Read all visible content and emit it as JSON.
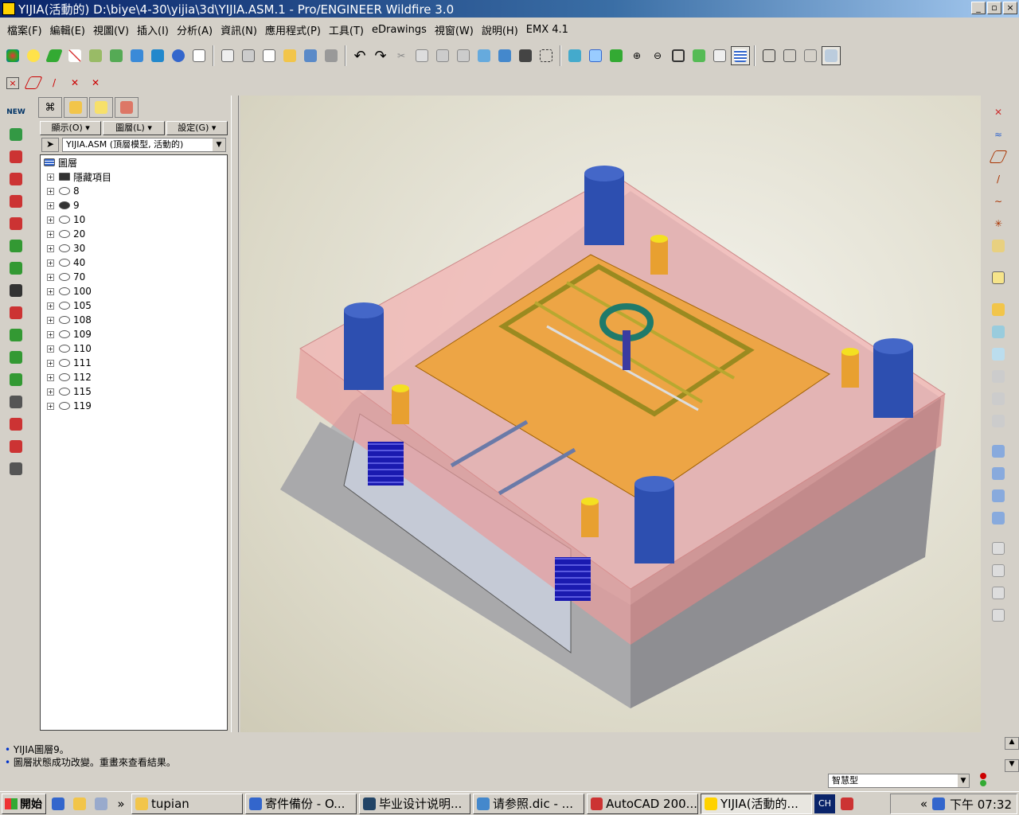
{
  "window": {
    "title": "YIJIA(活動的) D:\\biye\\4-30\\yijia\\3d\\YIJIA.ASM.1 - Pro/ENGINEER Wildfire 3.0",
    "min": "_",
    "max": "▫",
    "close": "×"
  },
  "menu": [
    "檔案(F)",
    "編輯(E)",
    "視圖(V)",
    "插入(I)",
    "分析(A)",
    "資訊(N)",
    "應用程式(P)",
    "工具(T)",
    "eDrawings",
    "視窗(W)",
    "說明(H)",
    "EMX 4.1"
  ],
  "nav": {
    "buttons": [
      "顯示(O) ▾",
      "圖層(L) ▾",
      "設定(G) ▾"
    ],
    "model_selector": "YIJIA.ASM (頂層模型, 活動的)",
    "tree_root": "圖層",
    "tree_items": [
      "隱藏項目",
      "8",
      "9",
      "10",
      "20",
      "30",
      "40",
      "70",
      "100",
      "105",
      "108",
      "109",
      "110",
      "111",
      "112",
      "115",
      "119"
    ]
  },
  "messages": [
    "YIJIA圖層9。",
    "圖層狀態成功改變。重畫來查看結果。"
  ],
  "status": {
    "filter": "智慧型"
  },
  "taskbar": {
    "start": "開始",
    "tasks": [
      "tupian",
      "寄件備份 - O...",
      "毕业设计说明...",
      "请参照.dic - ...",
      "AutoCAD 200...",
      "YIJIA(活動的..."
    ],
    "lang": "CH",
    "clock": "下午 07:32"
  },
  "colors": {
    "title_start": "#0a246a",
    "title_end": "#a6caf0",
    "accent": "#0033cc"
  }
}
